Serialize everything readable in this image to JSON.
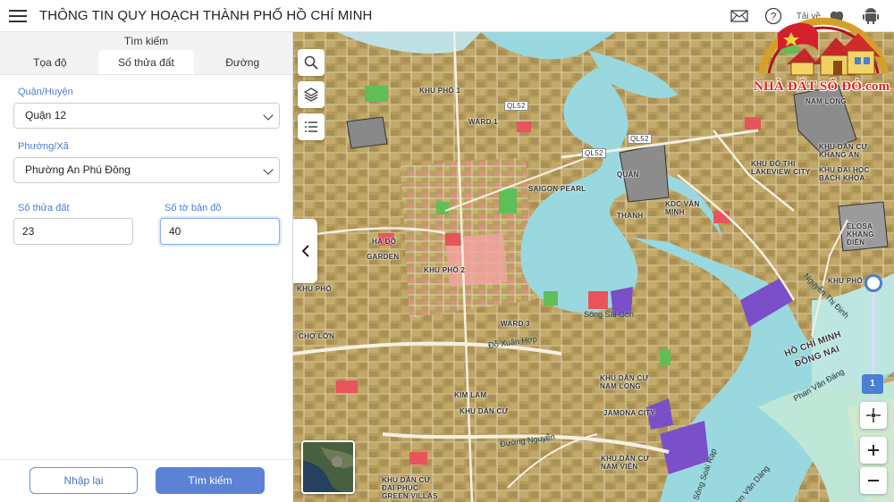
{
  "header": {
    "title": "THÔNG TIN QUY HOẠCH THÀNH PHỐ HỒ CHÍ MINH",
    "download_label": "Tải về",
    "icons": [
      "menu-icon",
      "mail-icon",
      "help-icon",
      "apple-icon",
      "android-icon"
    ]
  },
  "panel": {
    "title": "Tìm kiếm",
    "tabs": [
      {
        "label": "Tọa độ",
        "active": false
      },
      {
        "label": "Số thửa đất",
        "active": true
      },
      {
        "label": "Đường",
        "active": false
      }
    ],
    "district": {
      "label": "Quận/Huyện",
      "value": "Quận 12"
    },
    "ward": {
      "label": "Phường/Xã",
      "value": "Phường An Phú Đông"
    },
    "parcel": {
      "label": "Số thửa đất",
      "value": "23"
    },
    "sheet": {
      "label": "Số tờ bản đồ",
      "value": "40"
    },
    "reset_label": "Nhập lại",
    "search_label": "Tìm kiếm"
  },
  "map": {
    "zoom_level": "1",
    "labels": [
      "KHU PHỐ 1",
      "KHU PHỐ 2",
      "KHU PHỐ",
      "KHU PHỐ",
      "CHỢ LỚN",
      "WARD 3",
      "WARD 1",
      "KHU DÂN CƯ NAM LONG",
      "KHU DÂN CƯ",
      "KIM LAM",
      "JAMONA CITY",
      "KHU DÂN CƯ NAM VIỄN",
      "KHU DÂN CƯ ĐẠI PHÚC GREEN VILLAS",
      "SAIGON PEARL",
      "KHU ĐÔ THỊ LAKEVIEW CITY",
      "KDC VĂN MINH",
      "KHU DÂN CƯ KHANG AN",
      "KHU ĐẠI HỌC BÁCH KHOA",
      "ELOSA KHANG ĐIỀN",
      "NAM LONG",
      "GARDEN",
      "HÀ ĐÔ",
      "THẠNH",
      "QUẬN",
      "HỒ CHÍ MINH",
      "ĐỒNG NAI"
    ],
    "river_labels": [
      "Sông Sài Gòn",
      "Sông Soài Rạp",
      "Nam Văn Dàng",
      "Phan Văn Đáng",
      "Nguyễn Thị Định",
      "Đỗ Xuân Hợp",
      "Đường Nguyễn"
    ],
    "road_shields": [
      "QL52",
      "QL52",
      "QL52"
    ]
  },
  "logo": {
    "text": "NHÀ ĐẤT SỔ ĐỎ.com"
  },
  "colors": {
    "accent": "#4a7fd4",
    "primary_button": "#5b82d4",
    "river": "#9ad8df",
    "residential": "#b9a160",
    "commercial": "#e8545a",
    "park": "#5fbf56",
    "industrial": "#7b4fc7"
  }
}
